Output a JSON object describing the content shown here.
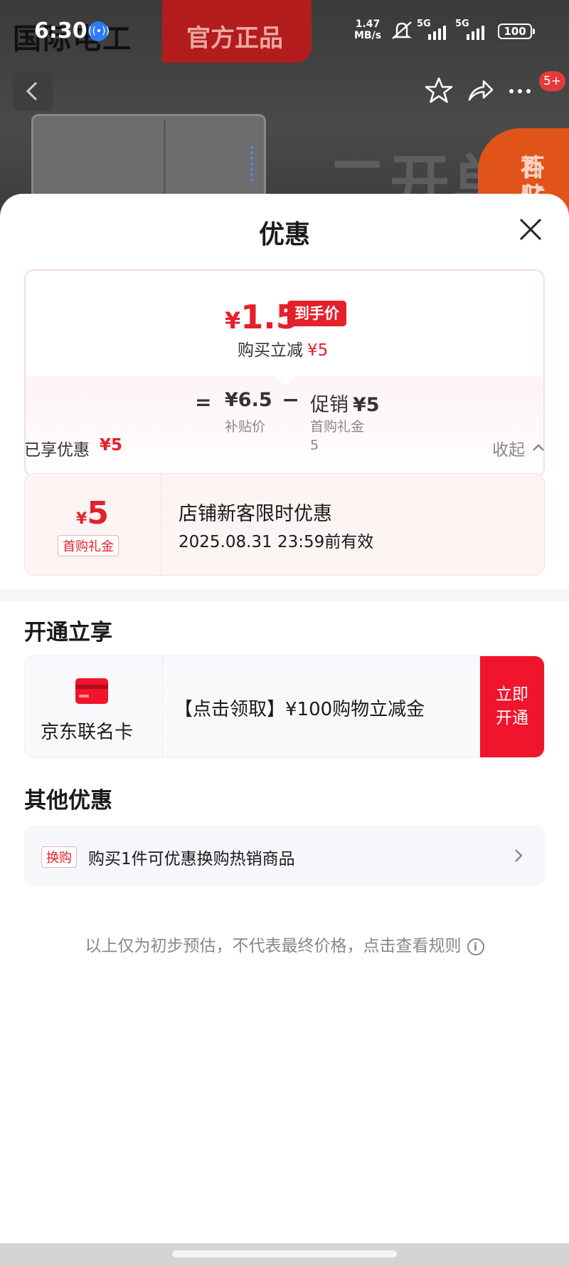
{
  "status_bar": {
    "time": "6:30",
    "speed_top": "1.47",
    "speed_bottom": "MB/s",
    "sim1": "5G",
    "sim2": "5G",
    "battery": "100"
  },
  "background": {
    "brand": "国际电工",
    "banner": "官方正品",
    "heading": "二开单",
    "badge_line1": "百亿",
    "badge_line2": "补贴",
    "notification_count": "5+"
  },
  "sheet": {
    "title": "优惠"
  },
  "price_card": {
    "currency": "¥",
    "final_price": "1.5",
    "final_tag": "到手价",
    "reduce_label": "购买立减",
    "reduce_amount": "¥5",
    "equals": "=",
    "subsidy_price": "¥6.5",
    "subsidy_label": "补贴价",
    "minus": "−",
    "promo_label": "促销",
    "promo_amount": "¥5",
    "promo_detail_line1": "首购礼金",
    "promo_detail_line2": "5"
  },
  "enjoyed": {
    "label": "已享优惠",
    "amount": "¥5",
    "collapse": "收起"
  },
  "coupon": {
    "currency": "¥",
    "amount": "5",
    "tag": "首购礼金",
    "title": "店铺新客限时优惠",
    "expiry": "2025.08.31 23:59前有效"
  },
  "open_section": {
    "title": "开通立享",
    "card_name": "京东联名卡",
    "offer": "【点击领取】¥100购物立减金",
    "button_line1": "立即",
    "button_line2": "开通"
  },
  "other_section": {
    "title": "其他优惠",
    "tag": "换购",
    "text": "购买1件可优惠换购热销商品"
  },
  "footer": {
    "note": "以上仅为初步预估，不代表最终价格，点击查看规则",
    "info_icon": "i"
  },
  "colors": {
    "accent_red": "#e4202a",
    "button_red": "#f0142c"
  }
}
